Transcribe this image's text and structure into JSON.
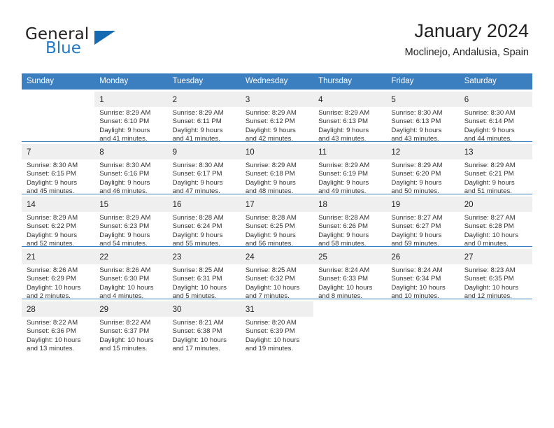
{
  "brand": {
    "name_part1": "General",
    "name_part2": "Blue",
    "flag_icon": "flag-triangle-icon",
    "accent_color": "#1569b0"
  },
  "header": {
    "title": "January 2024",
    "subtitle": "Moclinejo, Andalusia, Spain"
  },
  "calendar": {
    "header_bg": "#3c7fc1",
    "shade_bg": "#efefef",
    "weekdays": [
      "Sunday",
      "Monday",
      "Tuesday",
      "Wednesday",
      "Thursday",
      "Friday",
      "Saturday"
    ],
    "weeks": [
      [
        {
          "day": "",
          "sunrise": "",
          "sunset": "",
          "daylight1": "",
          "daylight2": ""
        },
        {
          "day": "1",
          "sunrise": "Sunrise: 8:29 AM",
          "sunset": "Sunset: 6:10 PM",
          "daylight1": "Daylight: 9 hours",
          "daylight2": "and 41 minutes."
        },
        {
          "day": "2",
          "sunrise": "Sunrise: 8:29 AM",
          "sunset": "Sunset: 6:11 PM",
          "daylight1": "Daylight: 9 hours",
          "daylight2": "and 41 minutes."
        },
        {
          "day": "3",
          "sunrise": "Sunrise: 8:29 AM",
          "sunset": "Sunset: 6:12 PM",
          "daylight1": "Daylight: 9 hours",
          "daylight2": "and 42 minutes."
        },
        {
          "day": "4",
          "sunrise": "Sunrise: 8:29 AM",
          "sunset": "Sunset: 6:13 PM",
          "daylight1": "Daylight: 9 hours",
          "daylight2": "and 43 minutes."
        },
        {
          "day": "5",
          "sunrise": "Sunrise: 8:30 AM",
          "sunset": "Sunset: 6:13 PM",
          "daylight1": "Daylight: 9 hours",
          "daylight2": "and 43 minutes."
        },
        {
          "day": "6",
          "sunrise": "Sunrise: 8:30 AM",
          "sunset": "Sunset: 6:14 PM",
          "daylight1": "Daylight: 9 hours",
          "daylight2": "and 44 minutes."
        }
      ],
      [
        {
          "day": "7",
          "sunrise": "Sunrise: 8:30 AM",
          "sunset": "Sunset: 6:15 PM",
          "daylight1": "Daylight: 9 hours",
          "daylight2": "and 45 minutes."
        },
        {
          "day": "8",
          "sunrise": "Sunrise: 8:30 AM",
          "sunset": "Sunset: 6:16 PM",
          "daylight1": "Daylight: 9 hours",
          "daylight2": "and 46 minutes."
        },
        {
          "day": "9",
          "sunrise": "Sunrise: 8:30 AM",
          "sunset": "Sunset: 6:17 PM",
          "daylight1": "Daylight: 9 hours",
          "daylight2": "and 47 minutes."
        },
        {
          "day": "10",
          "sunrise": "Sunrise: 8:29 AM",
          "sunset": "Sunset: 6:18 PM",
          "daylight1": "Daylight: 9 hours",
          "daylight2": "and 48 minutes."
        },
        {
          "day": "11",
          "sunrise": "Sunrise: 8:29 AM",
          "sunset": "Sunset: 6:19 PM",
          "daylight1": "Daylight: 9 hours",
          "daylight2": "and 49 minutes."
        },
        {
          "day": "12",
          "sunrise": "Sunrise: 8:29 AM",
          "sunset": "Sunset: 6:20 PM",
          "daylight1": "Daylight: 9 hours",
          "daylight2": "and 50 minutes."
        },
        {
          "day": "13",
          "sunrise": "Sunrise: 8:29 AM",
          "sunset": "Sunset: 6:21 PM",
          "daylight1": "Daylight: 9 hours",
          "daylight2": "and 51 minutes."
        }
      ],
      [
        {
          "day": "14",
          "sunrise": "Sunrise: 8:29 AM",
          "sunset": "Sunset: 6:22 PM",
          "daylight1": "Daylight: 9 hours",
          "daylight2": "and 52 minutes."
        },
        {
          "day": "15",
          "sunrise": "Sunrise: 8:29 AM",
          "sunset": "Sunset: 6:23 PM",
          "daylight1": "Daylight: 9 hours",
          "daylight2": "and 54 minutes."
        },
        {
          "day": "16",
          "sunrise": "Sunrise: 8:28 AM",
          "sunset": "Sunset: 6:24 PM",
          "daylight1": "Daylight: 9 hours",
          "daylight2": "and 55 minutes."
        },
        {
          "day": "17",
          "sunrise": "Sunrise: 8:28 AM",
          "sunset": "Sunset: 6:25 PM",
          "daylight1": "Daylight: 9 hours",
          "daylight2": "and 56 minutes."
        },
        {
          "day": "18",
          "sunrise": "Sunrise: 8:28 AM",
          "sunset": "Sunset: 6:26 PM",
          "daylight1": "Daylight: 9 hours",
          "daylight2": "and 58 minutes."
        },
        {
          "day": "19",
          "sunrise": "Sunrise: 8:27 AM",
          "sunset": "Sunset: 6:27 PM",
          "daylight1": "Daylight: 9 hours",
          "daylight2": "and 59 minutes."
        },
        {
          "day": "20",
          "sunrise": "Sunrise: 8:27 AM",
          "sunset": "Sunset: 6:28 PM",
          "daylight1": "Daylight: 10 hours",
          "daylight2": "and 0 minutes."
        }
      ],
      [
        {
          "day": "21",
          "sunrise": "Sunrise: 8:26 AM",
          "sunset": "Sunset: 6:29 PM",
          "daylight1": "Daylight: 10 hours",
          "daylight2": "and 2 minutes."
        },
        {
          "day": "22",
          "sunrise": "Sunrise: 8:26 AM",
          "sunset": "Sunset: 6:30 PM",
          "daylight1": "Daylight: 10 hours",
          "daylight2": "and 4 minutes."
        },
        {
          "day": "23",
          "sunrise": "Sunrise: 8:25 AM",
          "sunset": "Sunset: 6:31 PM",
          "daylight1": "Daylight: 10 hours",
          "daylight2": "and 5 minutes."
        },
        {
          "day": "24",
          "sunrise": "Sunrise: 8:25 AM",
          "sunset": "Sunset: 6:32 PM",
          "daylight1": "Daylight: 10 hours",
          "daylight2": "and 7 minutes."
        },
        {
          "day": "25",
          "sunrise": "Sunrise: 8:24 AM",
          "sunset": "Sunset: 6:33 PM",
          "daylight1": "Daylight: 10 hours",
          "daylight2": "and 8 minutes."
        },
        {
          "day": "26",
          "sunrise": "Sunrise: 8:24 AM",
          "sunset": "Sunset: 6:34 PM",
          "daylight1": "Daylight: 10 hours",
          "daylight2": "and 10 minutes."
        },
        {
          "day": "27",
          "sunrise": "Sunrise: 8:23 AM",
          "sunset": "Sunset: 6:35 PM",
          "daylight1": "Daylight: 10 hours",
          "daylight2": "and 12 minutes."
        }
      ],
      [
        {
          "day": "28",
          "sunrise": "Sunrise: 8:22 AM",
          "sunset": "Sunset: 6:36 PM",
          "daylight1": "Daylight: 10 hours",
          "daylight2": "and 13 minutes."
        },
        {
          "day": "29",
          "sunrise": "Sunrise: 8:22 AM",
          "sunset": "Sunset: 6:37 PM",
          "daylight1": "Daylight: 10 hours",
          "daylight2": "and 15 minutes."
        },
        {
          "day": "30",
          "sunrise": "Sunrise: 8:21 AM",
          "sunset": "Sunset: 6:38 PM",
          "daylight1": "Daylight: 10 hours",
          "daylight2": "and 17 minutes."
        },
        {
          "day": "31",
          "sunrise": "Sunrise: 8:20 AM",
          "sunset": "Sunset: 6:39 PM",
          "daylight1": "Daylight: 10 hours",
          "daylight2": "and 19 minutes."
        },
        {
          "day": "",
          "sunrise": "",
          "sunset": "",
          "daylight1": "",
          "daylight2": ""
        },
        {
          "day": "",
          "sunrise": "",
          "sunset": "",
          "daylight1": "",
          "daylight2": ""
        },
        {
          "day": "",
          "sunrise": "",
          "sunset": "",
          "daylight1": "",
          "daylight2": ""
        }
      ]
    ]
  }
}
